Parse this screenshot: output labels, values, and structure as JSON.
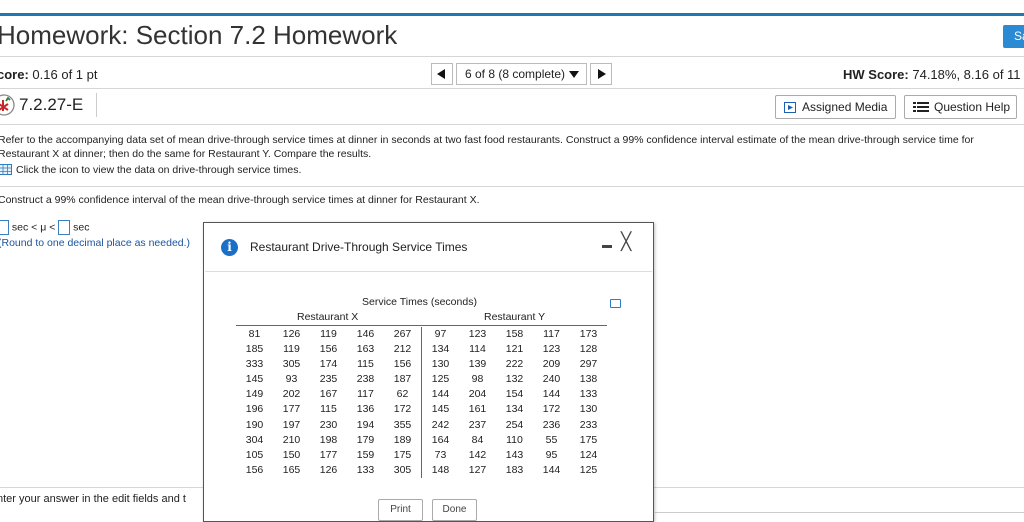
{
  "header": {
    "title": "Homework: Section 7.2 Homework",
    "save_label": "Sa"
  },
  "score_bar": {
    "score_label": "core:",
    "score_value": "0.16 of 1 pt",
    "progress_text": "6 of 8 (8 complete)",
    "hw_score_label": "HW Score:",
    "hw_score_value": "74.18%, 8.16 of 11"
  },
  "question": {
    "id": "7.2.27-E",
    "status_icon": "partial-credit-icon",
    "assigned_media_label": "Assigned Media",
    "question_help_label": "Question Help",
    "prompt": "Refer to the accompanying data set of mean drive-through service times at dinner in seconds at two fast food restaurants. Construct a 99% confidence interval estimate of the mean drive-through service time for Restaurant X at dinner; then do the same for Restaurant Y. Compare the results.",
    "click_text": "Click the icon to view the data on drive-through service times.",
    "construct_text": "Construct a 99% confidence interval of the mean drive-through service times at dinner for Restaurant X.",
    "answer_mid": "sec < μ <",
    "answer_end": "sec",
    "round_note": "(Round to one decimal place as needed.)",
    "enter_text": "nter your answer in the edit fields and t"
  },
  "dialog": {
    "title": "Restaurant Drive-Through Service Times",
    "table_title": "Service Times (seconds)",
    "restaurant_x_label": "Restaurant X",
    "restaurant_y_label": "Restaurant Y",
    "rows": [
      {
        "x": [
          "81",
          "126",
          "119",
          "146",
          "267"
        ],
        "y": [
          "97",
          "123",
          "158",
          "117",
          "173"
        ]
      },
      {
        "x": [
          "185",
          "119",
          "156",
          "163",
          "212"
        ],
        "y": [
          "134",
          "114",
          "121",
          "123",
          "128"
        ]
      },
      {
        "x": [
          "333",
          "305",
          "174",
          "115",
          "156"
        ],
        "y": [
          "130",
          "139",
          "222",
          "209",
          "297"
        ]
      },
      {
        "x": [
          "145",
          "93",
          "235",
          "238",
          "187"
        ],
        "y": [
          "125",
          "98",
          "132",
          "240",
          "138"
        ]
      },
      {
        "x": [
          "149",
          "202",
          "167",
          "117",
          "62"
        ],
        "y": [
          "144",
          "204",
          "154",
          "144",
          "133"
        ]
      },
      {
        "x": [
          "196",
          "177",
          "115",
          "136",
          "172"
        ],
        "y": [
          "145",
          "161",
          "134",
          "172",
          "130"
        ]
      },
      {
        "x": [
          "190",
          "197",
          "230",
          "194",
          "355"
        ],
        "y": [
          "242",
          "237",
          "254",
          "236",
          "233"
        ]
      },
      {
        "x": [
          "304",
          "210",
          "198",
          "179",
          "189"
        ],
        "y": [
          "164",
          "84",
          "110",
          "55",
          "175"
        ]
      },
      {
        "x": [
          "105",
          "150",
          "177",
          "159",
          "175"
        ],
        "y": [
          "73",
          "142",
          "143",
          "95",
          "124"
        ]
      },
      {
        "x": [
          "156",
          "165",
          "126",
          "133",
          "305"
        ],
        "y": [
          "148",
          "127",
          "183",
          "144",
          "125"
        ]
      }
    ],
    "print_label": "Print",
    "done_label": "Done"
  }
}
